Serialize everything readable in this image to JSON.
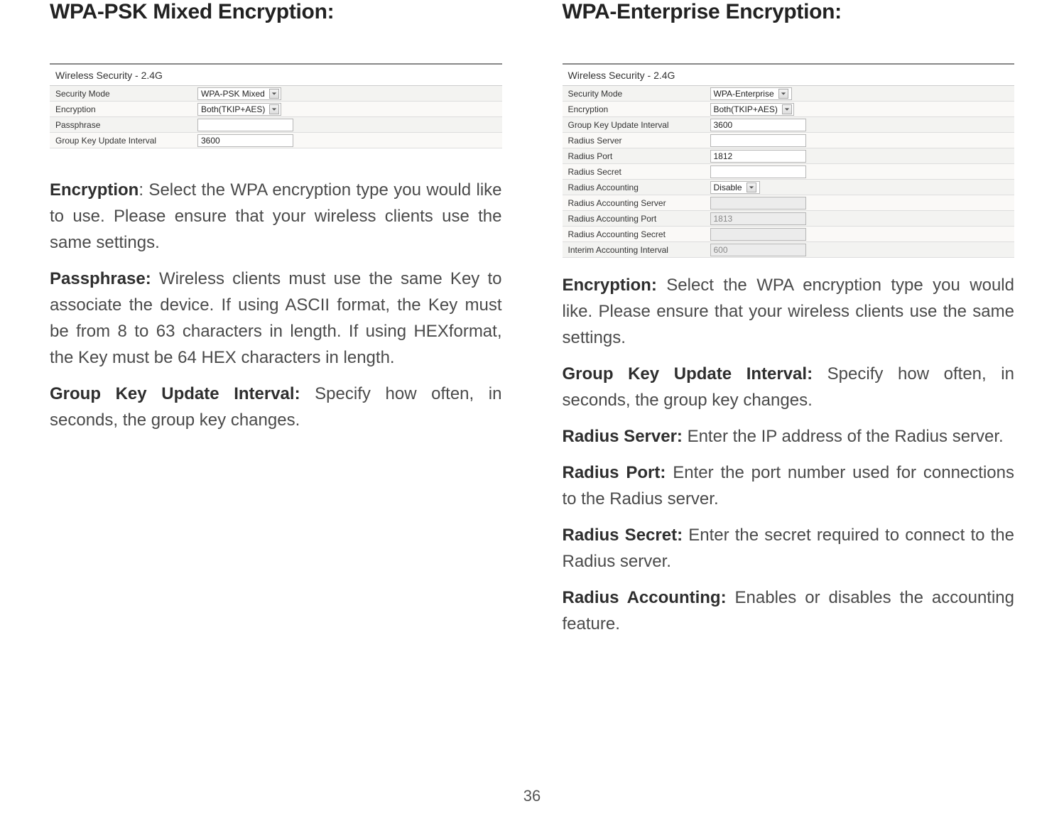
{
  "left": {
    "heading": "WPA-PSK Mixed Encryption:",
    "form": {
      "title": "Wireless Security - 2.4G",
      "rows": [
        {
          "label": "Security Mode",
          "value": "WPA-PSK Mixed",
          "kind": "select"
        },
        {
          "label": "Encryption",
          "value": "Both(TKIP+AES)",
          "kind": "select"
        },
        {
          "label": "Passphrase",
          "value": "",
          "kind": "text"
        },
        {
          "label": "Group Key Update Interval",
          "value": "3600",
          "kind": "text"
        }
      ]
    },
    "p1_term": "Encryption",
    "p1_rest": ": Select the WPA encryption type you would like to use. Please ensure that your wireless clients use the same settings.",
    "p2_term": "Passphrase:",
    "p2_rest": " Wireless clients must use the same Key to associate the device. If using ASCII format, the Key must be from 8 to 63 characters in length. If using HEXformat, the Key must be 64 HEX characters in length.",
    "p3_term": "Group Key Update Interval:",
    "p3_rest": " Specify how often, in seconds, the group key changes."
  },
  "right": {
    "heading": "WPA-Enterprise Encryption:",
    "form": {
      "title": "Wireless Security - 2.4G",
      "rows": [
        {
          "label": "Security Mode",
          "value": "WPA-Enterprise",
          "kind": "select"
        },
        {
          "label": "Encryption",
          "value": "Both(TKIP+AES)",
          "kind": "select"
        },
        {
          "label": "Group Key Update Interval",
          "value": "3600",
          "kind": "text"
        },
        {
          "label": "Radius Server",
          "value": "",
          "kind": "text"
        },
        {
          "label": "Radius Port",
          "value": "1812",
          "kind": "text"
        },
        {
          "label": "Radius Secret",
          "value": "",
          "kind": "text"
        },
        {
          "label": "Radius Accounting",
          "value": "Disable",
          "kind": "select-small"
        },
        {
          "label": "Radius Accounting Server",
          "value": "",
          "kind": "text-dis"
        },
        {
          "label": "Radius Accounting Port",
          "value": "1813",
          "kind": "text-dis"
        },
        {
          "label": "Radius Accounting Secret",
          "value": "",
          "kind": "text-dis"
        },
        {
          "label": "Interim Accounting Interval",
          "value": "600",
          "kind": "text-dis"
        }
      ]
    },
    "p1_term": "Encryption:",
    "p1_rest": " Select the WPA encryption type you would like. Please ensure that your wireless clients use the same settings.",
    "p2_term": "Group Key Update Interval:",
    "p2_rest": " Specify how often, in seconds, the group key changes.",
    "p3_term": "Radius Server:",
    "p3_rest": " Enter the IP address of the Radius server.",
    "p4_term": "Radius Port:",
    "p4_rest": " Enter the port number used for connections to the Radius server.",
    "p5_term": "Radius Secret:",
    "p5_rest": " Enter the secret required to connect to the Radius server.",
    "p6_term": "Radius Accounting:",
    "p6_rest": " Enables or disables the  accounting feature."
  },
  "page_number": "36"
}
